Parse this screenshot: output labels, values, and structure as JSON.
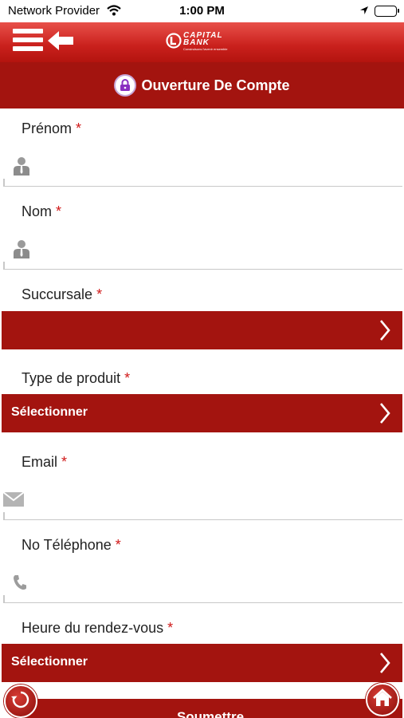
{
  "status_bar": {
    "carrier": "Network Provider",
    "time": "1:00 PM"
  },
  "header": {
    "logo_text": "CAPITAL BANK",
    "logo_tagline": "Construisons l'avenir ensemble",
    "menu_icon": "hamburger-menu-icon",
    "back_icon": "back-arrow-icon"
  },
  "page": {
    "title": "Ouverture De Compte",
    "title_icon": "lock-icon"
  },
  "form": {
    "required_marker": "*",
    "first_name": {
      "label": "Prénom",
      "value": "",
      "icon": "person-icon"
    },
    "last_name": {
      "label": "Nom",
      "value": "",
      "icon": "person-icon"
    },
    "branch": {
      "label": "Succursale",
      "selected": ""
    },
    "product_type": {
      "label": "Type de produit",
      "selected": "Sélectionner"
    },
    "email": {
      "label": "Email",
      "value": "",
      "icon": "envelope-icon"
    },
    "phone": {
      "label": "No Téléphone",
      "value": "",
      "icon": "phone-icon"
    },
    "appointment_time": {
      "label": "Heure du rendez-vous",
      "selected": "Sélectionner"
    },
    "submit_label": "Soumettre"
  },
  "colors": {
    "primary": "#a3140f",
    "header_gradient_top": "#e8504a",
    "required": "#d01818"
  }
}
